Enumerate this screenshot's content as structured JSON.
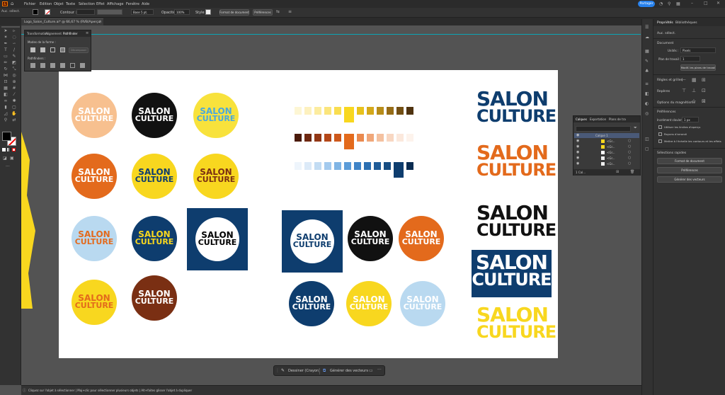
{
  "menubar": {
    "app_badge": "Ai",
    "items": [
      "Fichier",
      "Edition",
      "Objet",
      "Texte",
      "Sélection",
      "Effet",
      "Affichage",
      "Fenêtre",
      "Aide"
    ],
    "share_label": "Partager"
  },
  "controlbar": {
    "contour_label": "Contour :",
    "stroke_style": "Uniforme",
    "stroke_profile": "Base 5 pt.",
    "opacity_label": "Opacité :",
    "opacity_value": "100%",
    "style_label": "Style :",
    "doc_format_btn": "Format de document",
    "prefs_btn": "Préférences"
  },
  "document": {
    "tab_title": "Logo_Salon_Culture.ai* @ 66,67 % (RVB/Aperçu)",
    "side_label": "Auc. sélect."
  },
  "pathfinder_panel": {
    "tabs": [
      "Transformation",
      "Alignement",
      "Pathfinder"
    ],
    "shape_modes_label": "Modes de la forme :",
    "expand_btn": "Décomposer",
    "pathfinders_label": "Pathfinders :"
  },
  "layers_panel": {
    "tabs": [
      "Calques",
      "Exportation",
      "Plans de tra"
    ],
    "layer_name": "Calque 1",
    "sublayers": [
      "<Gr...",
      "<Gr...",
      "<Gr...",
      "<Gr...",
      "<Gr..."
    ],
    "count_label": "1 Cal..."
  },
  "properties_panel": {
    "tabs": [
      "Propriétés",
      "Bibliothèques"
    ],
    "no_selection": "Auc. sélect.",
    "document_label": "Document",
    "units_label": "Unités :",
    "units_value": "Pixels",
    "artboard_label": "Plan de travail :",
    "artboard_value": "1",
    "edit_artboards_btn": "Modif. les plans de travail",
    "rulers_label": "Règles et grilles",
    "guides_label": "Repères",
    "snap_label": "Options du magnétisme",
    "prefs_label": "Préférences",
    "keyboard_inc_label": "Incrément clavier :",
    "keyboard_inc_value": "1 px",
    "chk_preview_bounds": "Utiliser les limites d'aperçu",
    "chk_round_corners": "Mettre à l'échelle les contours et les effets",
    "chk_corners": "Rayons d'arrondi",
    "quick_actions_label": "Sélections rapides",
    "doc_format_btn": "Format de document",
    "prefs_btn": "Préférences",
    "vectors_btn": "Générer des vecteurs"
  },
  "taskbar": {
    "draw_btn": "Dessiner (Crayon)",
    "generate_btn": "Générer des vecteurs"
  },
  "statusbar": {
    "text": "Cliquez sur l'objet à sélectionner  |  Maj+clic pour sélectionner plusieurs objets  |  Alt+faites glisser l'objet à dupliquer"
  },
  "artwork": {
    "word1": "SALON",
    "word2": "CULTURE"
  },
  "colors": {
    "ui_dark": "#323232",
    "accent_blue": "#2680eb",
    "orange": "#e36a1c",
    "navy": "#0e3d6e",
    "yellow": "#f8d71f",
    "brown": "#7a2f13",
    "peach": "#f7c08f",
    "lightblue": "#b9d9f0"
  }
}
